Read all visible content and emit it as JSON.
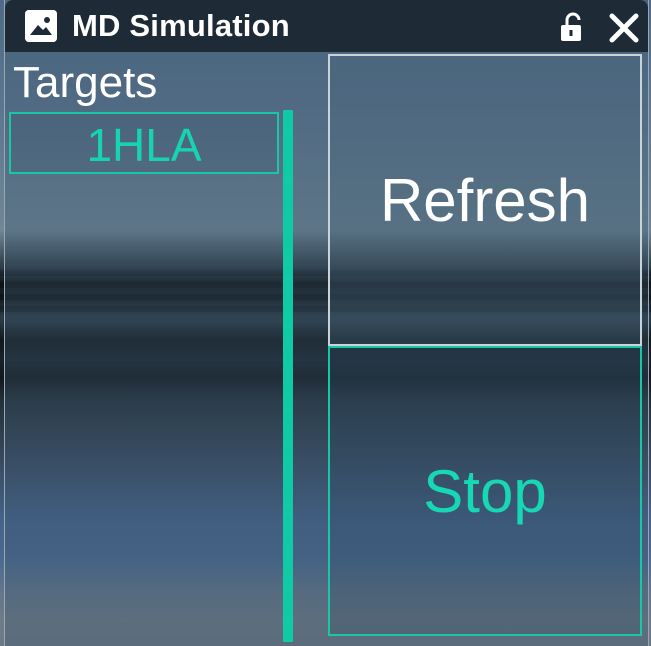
{
  "window": {
    "title": "MD Simulation",
    "app_icon": "landscape-icon",
    "lock_icon": "unlock-icon",
    "close_icon": "close-icon"
  },
  "targets": {
    "label": "Targets",
    "items": [
      {
        "label": "1HLA"
      }
    ]
  },
  "actions": {
    "refresh_label": "Refresh",
    "stop_label": "Stop"
  },
  "colors": {
    "accent": "#17c7a6",
    "titlebar": "#1e2a36",
    "text": "#ffffff"
  }
}
